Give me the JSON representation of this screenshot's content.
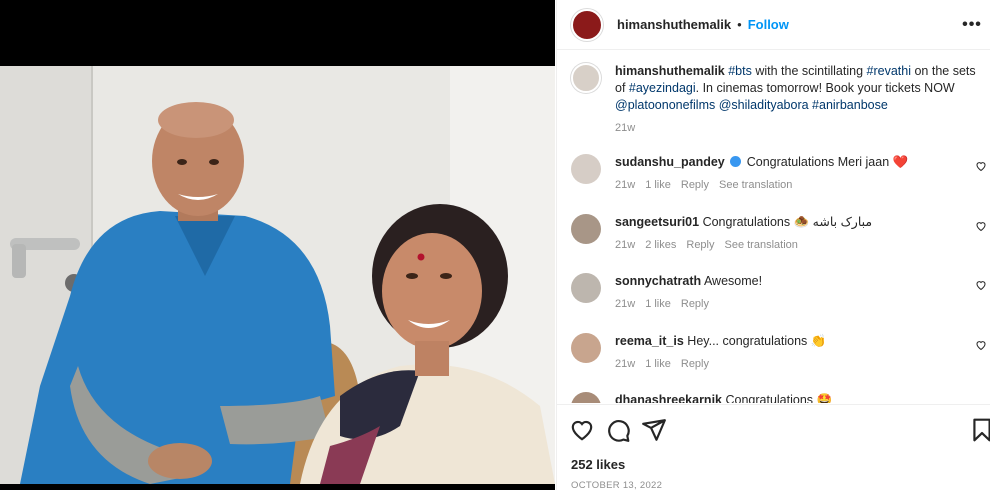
{
  "post": {
    "username": "himanshuthemalik",
    "separator": "•",
    "follow_label": "Follow",
    "more_label": "•••",
    "caption": {
      "username": "himanshuthemalik",
      "t1": "#bts",
      "s1": " with the scintillating ",
      "t2": "#revathi",
      "s2": " on the sets of ",
      "t3": "#ayezindagi",
      "s3": ". In cinemas tomorrow! Book your tickets NOW ",
      "t4": "@platoononefilms",
      "s4": " ",
      "t5": "@shiladityabora",
      "s5": " ",
      "t6": "#anirbanbose",
      "time": "21w"
    },
    "likes": "252 likes",
    "date": "OCTOBER 13, 2022"
  },
  "comments": [
    {
      "user": "sudanshu_pandey",
      "text": "Congratulations Meri jaan",
      "emoji": "❤️",
      "time": "21w",
      "likes": "1 like",
      "reply": "Reply",
      "translate": "See translation"
    },
    {
      "user": "sangeetsuri01",
      "text": "Congratulations",
      "emoji": "🧆",
      "text2": "مبارک باشه",
      "time": "21w",
      "likes": "2 likes",
      "reply": "Reply",
      "translate": "See translation"
    },
    {
      "user": "sonnychatrath",
      "text": "Awesome!",
      "time": "21w",
      "likes": "1 like",
      "reply": "Reply"
    },
    {
      "user": "reema_it_is",
      "text": "Hey... congratulations",
      "emoji": "👏",
      "time": "21w",
      "likes": "1 like",
      "reply": "Reply"
    },
    {
      "user": "dhanashreekarnik",
      "text": "Congratulations",
      "emoji": "🤩"
    }
  ],
  "colors": {
    "link": "#00376b",
    "follow": "#0095f6",
    "muted": "#8e8e8e",
    "avatar_post": "#8b1a1a"
  },
  "icons": [
    "more-icon",
    "verified-icon",
    "heart-icon",
    "comment-icon",
    "share-icon",
    "bookmark-icon"
  ]
}
